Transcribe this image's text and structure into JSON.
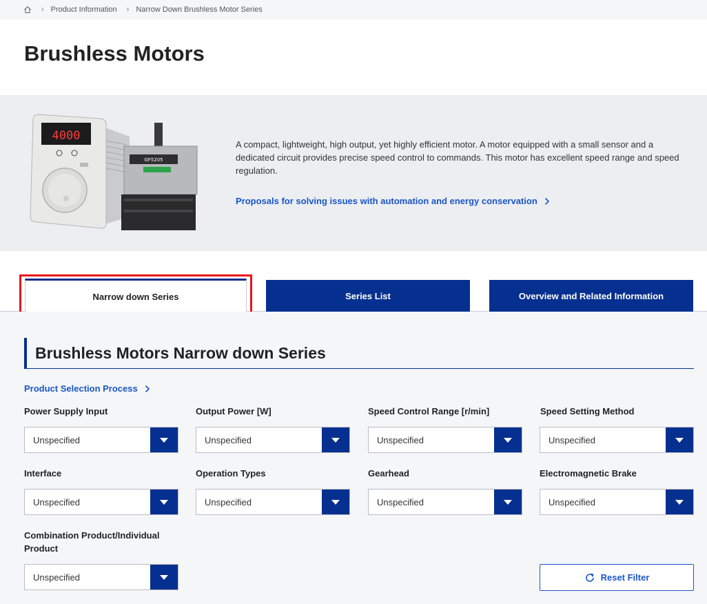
{
  "breadcrumb": {
    "items": [
      "Product Information",
      "Narrow Down Brushless Motor Series"
    ]
  },
  "page": {
    "title": "Brushless Motors"
  },
  "hero": {
    "description": "A compact, lightweight, high output, yet highly efficient motor. A motor equipped with a small sensor and a dedicated circuit provides precise speed control to commands. This motor has excellent speed range and speed regulation.",
    "link": "Proposals for solving issues with automation and energy conservation",
    "display_value": "4000",
    "motor_label": "GF5205"
  },
  "tabs": [
    {
      "label": "Narrow down Series"
    },
    {
      "label": "Series List"
    },
    {
      "label": "Overview and Related Information"
    }
  ],
  "filter": {
    "title": "Brushless Motors Narrow down Series",
    "process_link": "Product Selection Process",
    "fields": [
      {
        "label": "Power Supply Input",
        "value": "Unspecified"
      },
      {
        "label": "Output Power [W]",
        "value": "Unspecified"
      },
      {
        "label": "Speed Control Range [r/min]",
        "value": "Unspecified"
      },
      {
        "label": "Speed Setting Method",
        "value": "Unspecified"
      },
      {
        "label": "Interface",
        "value": "Unspecified"
      },
      {
        "label": "Operation Types",
        "value": "Unspecified"
      },
      {
        "label": "Gearhead",
        "value": "Unspecified"
      },
      {
        "label": "Electromagnetic Brake",
        "value": "Unspecified"
      },
      {
        "label": "Combination Product/Individual Product",
        "value": "Unspecified"
      }
    ],
    "reset_label": "Reset Filter"
  },
  "colors": {
    "brand_blue": "#06308f",
    "link_blue": "#1a55c8",
    "highlight_red": "#e8131b"
  }
}
